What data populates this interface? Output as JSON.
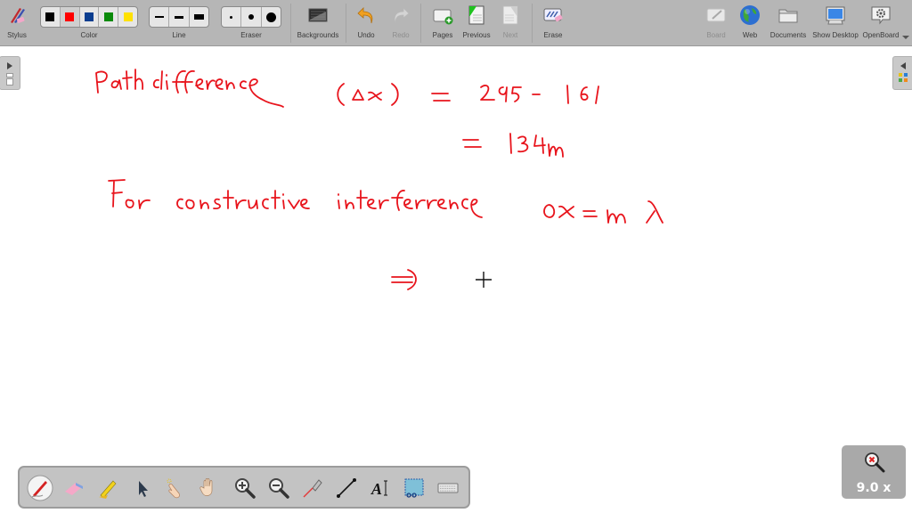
{
  "toolbar": {
    "stylus": "Stylus",
    "color": "Color",
    "line": "Line",
    "eraser": "Eraser",
    "backgrounds": "Backgrounds",
    "undo": "Undo",
    "redo": "Redo",
    "pages": "Pages",
    "previous": "Previous",
    "next": "Next",
    "erase": "Erase",
    "board": "Board",
    "web": "Web",
    "documents": "Documents",
    "show_desktop": "Show Desktop",
    "openboard": "OpenBoard",
    "colors": [
      "#000000",
      "#ff0000",
      "#0a3d8f",
      "#0a8a0a",
      "#ffe100"
    ],
    "selected_color_index": 1,
    "line_widths": [
      "thin",
      "medium",
      "thick"
    ],
    "eraser_sizes": [
      "small",
      "medium",
      "large"
    ]
  },
  "board": {
    "ink_color": "#e8141c",
    "lines": [
      "Path difference  (Δx) = 295 - 161",
      "= 134m",
      "For constructive interference   Δx = mλ",
      "⇒"
    ]
  },
  "bottom_tools": [
    "pen",
    "eraser",
    "marker",
    "selector",
    "interact",
    "hand",
    "zoom-in",
    "zoom-out",
    "laser-pointer",
    "line",
    "text",
    "capture",
    "virtual-keyboard"
  ],
  "zoom": {
    "level": "9.0 x"
  }
}
